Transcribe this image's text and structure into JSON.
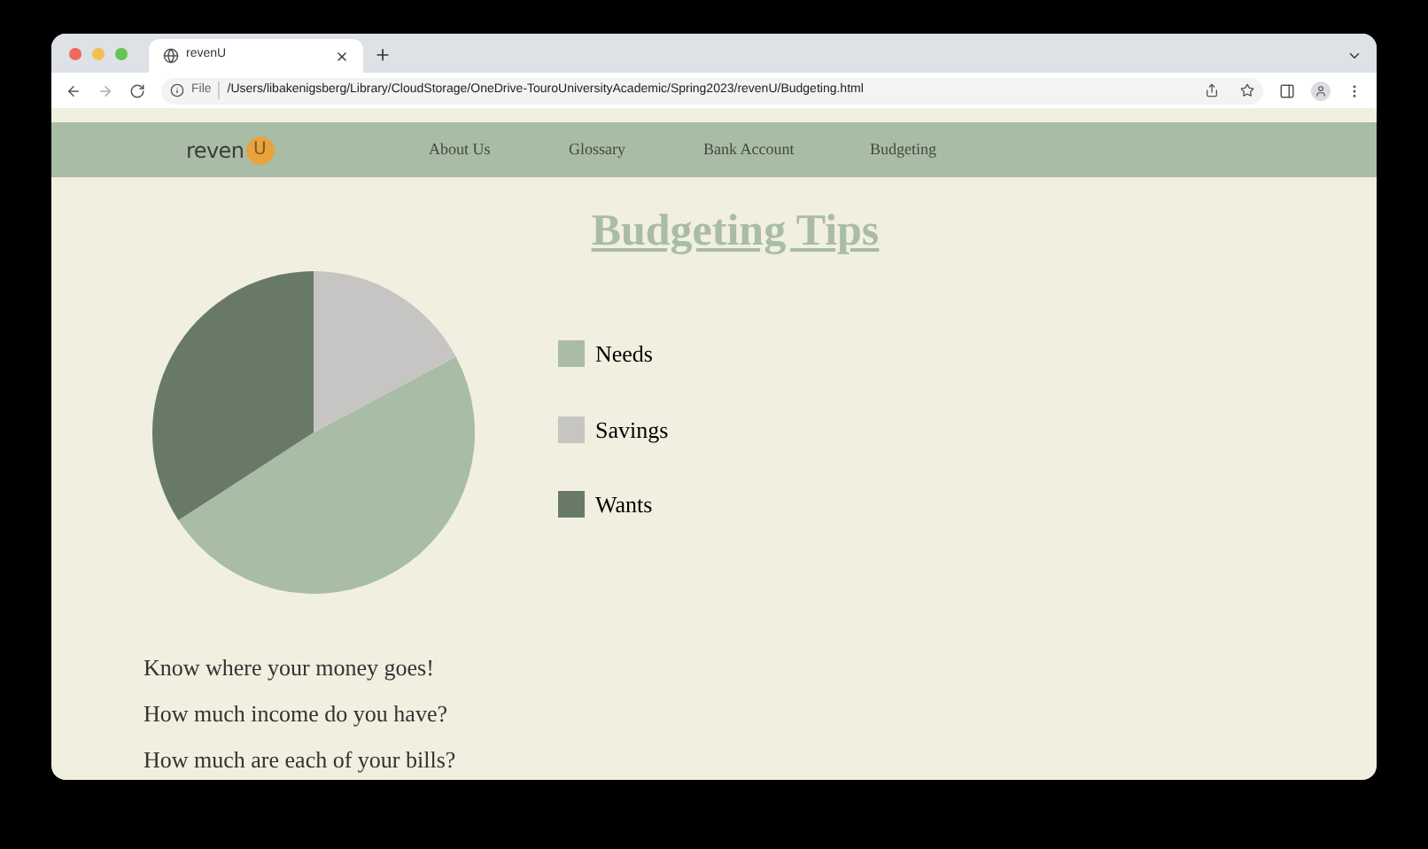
{
  "browser": {
    "tab": {
      "title": "revenU",
      "selected": true
    },
    "address": {
      "scheme": "File",
      "url": "/Users/libakenigsberg/Library/CloudStorage/OneDrive-TouroUniversityAcademic/Spring2023/revenU/Budgeting.html"
    }
  },
  "nav": {
    "logo": {
      "text": "reven",
      "badge": "U"
    },
    "links": [
      {
        "label": "About Us"
      },
      {
        "label": "Glossary"
      },
      {
        "label": "Bank Account"
      },
      {
        "label": "Budgeting"
      }
    ]
  },
  "title": "Budgeting Tips",
  "legend": [
    {
      "label": "Needs",
      "color": "#a9bca5"
    },
    {
      "label": "Savings",
      "color": "#c6c5c4"
    },
    {
      "label": "Wants",
      "color": "#687a67"
    }
  ],
  "tips": [
    "Know where your money goes!",
    "How much income do you have?",
    "How much are each of your bills?"
  ]
}
